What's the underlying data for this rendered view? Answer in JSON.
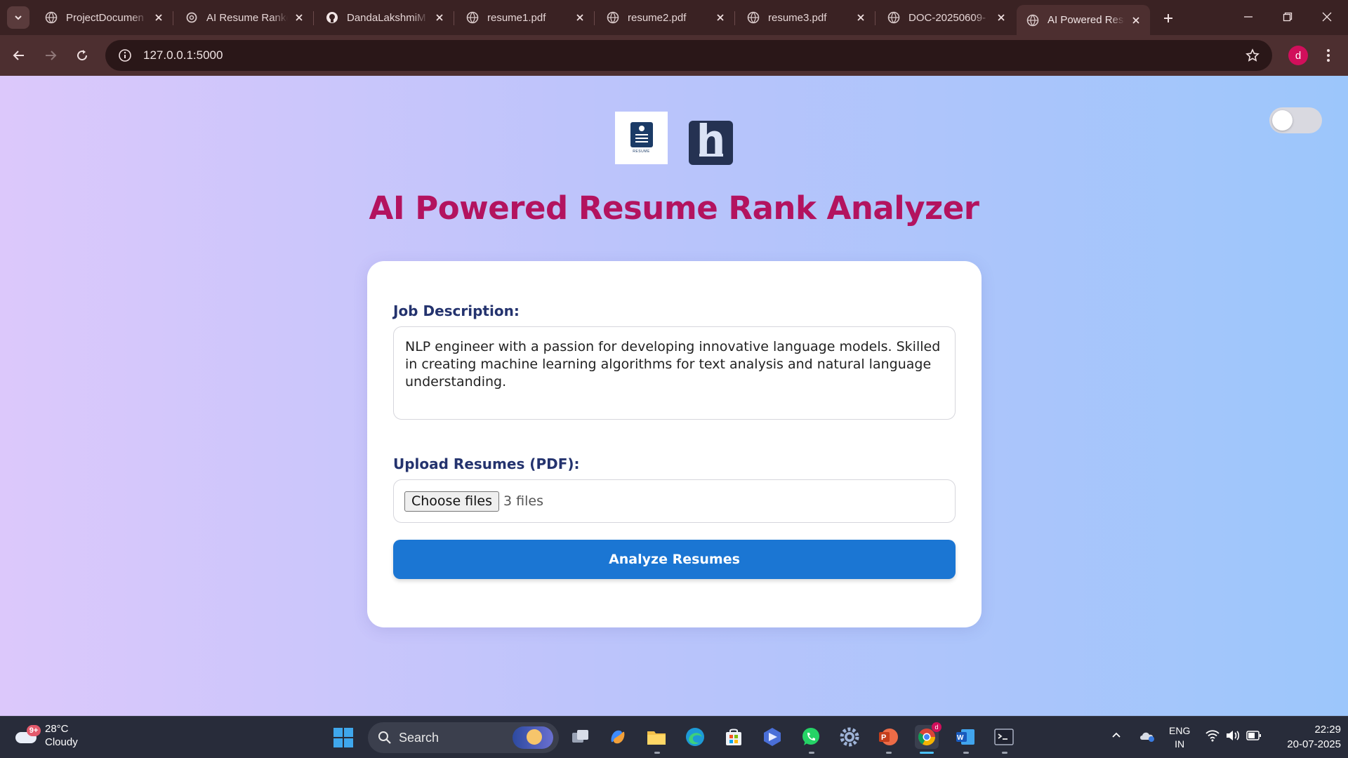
{
  "browser": {
    "tabs": [
      {
        "title": "ProjectDocumen",
        "icon": "globe-icon"
      },
      {
        "title": "AI Resume Ranke",
        "icon": "openai-icon"
      },
      {
        "title": "DandaLakshmiM",
        "icon": "github-icon"
      },
      {
        "title": "resume1.pdf",
        "icon": "globe-icon"
      },
      {
        "title": "resume2.pdf",
        "icon": "globe-icon"
      },
      {
        "title": "resume3.pdf",
        "icon": "globe-icon"
      },
      {
        "title": "DOC-20250609-",
        "icon": "globe-icon"
      },
      {
        "title": "AI Powered Resu",
        "icon": "globe-icon",
        "active": true
      }
    ],
    "url": "127.0.0.1:5000",
    "profile_initial": "d"
  },
  "page": {
    "title": "AI Powered Resume Rank Analyzer",
    "logo1_caption": "RESUME",
    "logo2_letter": "h",
    "theme_toggle": "off",
    "job_description_label": "Job Description:",
    "job_description_text": "NLP engineer with a passion for developing innovative language models. Skilled in creating machine learning algorithms for text analysis and natural language understanding.",
    "upload_label": "Upload Resumes (PDF):",
    "choose_files_label": "Choose files",
    "files_status": "3 files",
    "analyze_button": "Analyze Resumes",
    "colors": {
      "title": "#b3135f",
      "labels": "#24336e",
      "button": "#1b76d3"
    }
  },
  "taskbar": {
    "weather_temp": "28°C",
    "weather_desc": "Cloudy",
    "weather_badge": "9+",
    "search_placeholder": "Search",
    "chrome_badge": "d",
    "tray_lang_1": "ENG",
    "tray_lang_2": "IN",
    "time": "22:29",
    "date": "20-07-2025"
  }
}
